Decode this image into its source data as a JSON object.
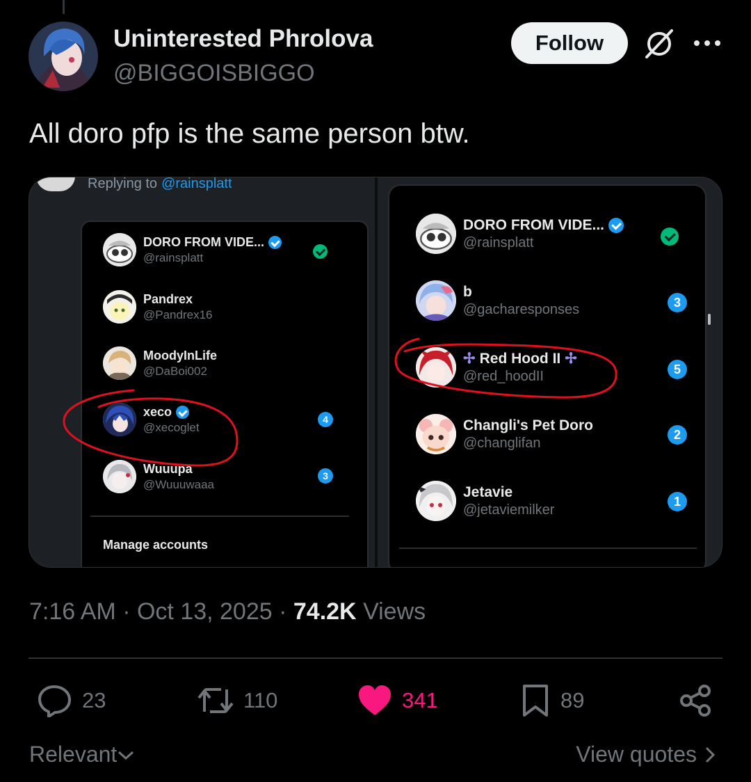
{
  "author": {
    "display_name": "Uninterested Phrolova",
    "handle": "@BIGGOISBIGGO",
    "follow_label": "Follow"
  },
  "tweet": {
    "text": "All doro pfp is the same person btw."
  },
  "media": {
    "left": {
      "replying_prefix": "Replying to",
      "replying_handle": "@rainsplatt",
      "accounts": [
        {
          "name": "DORO FROM VIDE...",
          "handle": "@rainsplatt",
          "verified": true,
          "badge": "check"
        },
        {
          "name": "Pandrex",
          "handle": "@Pandrex16",
          "verified": false,
          "badge": ""
        },
        {
          "name": "MoodyInLife",
          "handle": "@DaBoi002",
          "verified": false,
          "badge": ""
        },
        {
          "name": "xeco",
          "handle": "@xecoglet",
          "verified": true,
          "badge": "4"
        },
        {
          "name": "Wuuupa",
          "handle": "@Wuuuwaaa",
          "verified": false,
          "badge": "3"
        }
      ],
      "manage_label": "Manage accounts"
    },
    "right": {
      "accounts": [
        {
          "name": "DORO FROM VIDE...",
          "handle": "@rainsplatt",
          "verified": true,
          "badge": "check"
        },
        {
          "name": "b",
          "handle": "@gacharesponses",
          "verified": false,
          "badge": "3"
        },
        {
          "name": "Red Hood II",
          "handle": "@red_hoodII",
          "verified": false,
          "badge": "5"
        },
        {
          "name": "Changli's Pet Doro",
          "handle": "@changlifan",
          "verified": false,
          "badge": "2"
        },
        {
          "name": "Jetavie",
          "handle": "@jetaviemilker",
          "verified": false,
          "badge": "1"
        }
      ]
    },
    "annotation_color": "#e0101e"
  },
  "meta": {
    "time": "7:16 AM",
    "date": "Oct 13, 2025",
    "views_count": "74.2K",
    "views_label": "Views"
  },
  "actions": {
    "replies": "23",
    "reposts": "110",
    "likes": "341",
    "bookmarks": "89"
  },
  "footer": {
    "sort_label": "Relevant",
    "quotes_label": "View quotes"
  },
  "colors": {
    "background": "#000000",
    "text": "#e7e9ea",
    "secondary": "#71767b",
    "like": "#f91880",
    "accent": "#1d9bf0"
  },
  "icons": [
    "grok-icon",
    "more-icon",
    "reply-icon",
    "repost-icon",
    "heart-icon",
    "bookmark-icon",
    "share-icon",
    "chevron-down-icon",
    "chevron-right-icon",
    "verified-badge-icon"
  ]
}
